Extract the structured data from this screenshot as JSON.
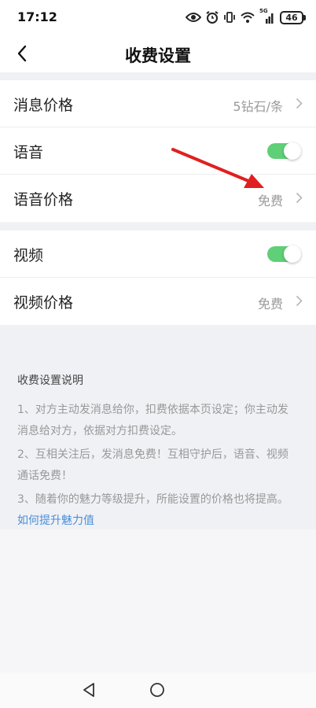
{
  "status": {
    "time": "17:12",
    "network": "5G",
    "battery": "46"
  },
  "header": {
    "title": "收费设置"
  },
  "group1": {
    "message_price": {
      "label": "消息价格",
      "value": "5钻石/条"
    },
    "voice": {
      "label": "语音",
      "enabled": true
    },
    "voice_price": {
      "label": "语音价格",
      "value": "免费"
    }
  },
  "group2": {
    "video": {
      "label": "视频",
      "enabled": true
    },
    "video_price": {
      "label": "视频价格",
      "value": "免费"
    }
  },
  "description": {
    "title": "收费设置说明",
    "item1": "1、对方主动发消息给你，扣费依据本页设定；你主动发消息给对方，依据对方扣费设定。",
    "item2": "2、互相关注后，发消息免费！互相守护后，语音、视频通话免费！",
    "item3": "3、随着你的魅力等级提升，所能设置的价格也将提高。",
    "item3_link": "如何提升魅力值"
  },
  "colors": {
    "toggle_on": "#5fcf78",
    "link": "#4a8ed6",
    "annotation_arrow": "#e02020"
  },
  "icons": [
    "eye-icon",
    "alarm-icon",
    "vibrate-icon",
    "wifi-icon",
    "signal-icon",
    "battery-icon",
    "back-arrow-icon",
    "chevron-right-icon",
    "nav-back-icon",
    "nav-home-icon"
  ]
}
